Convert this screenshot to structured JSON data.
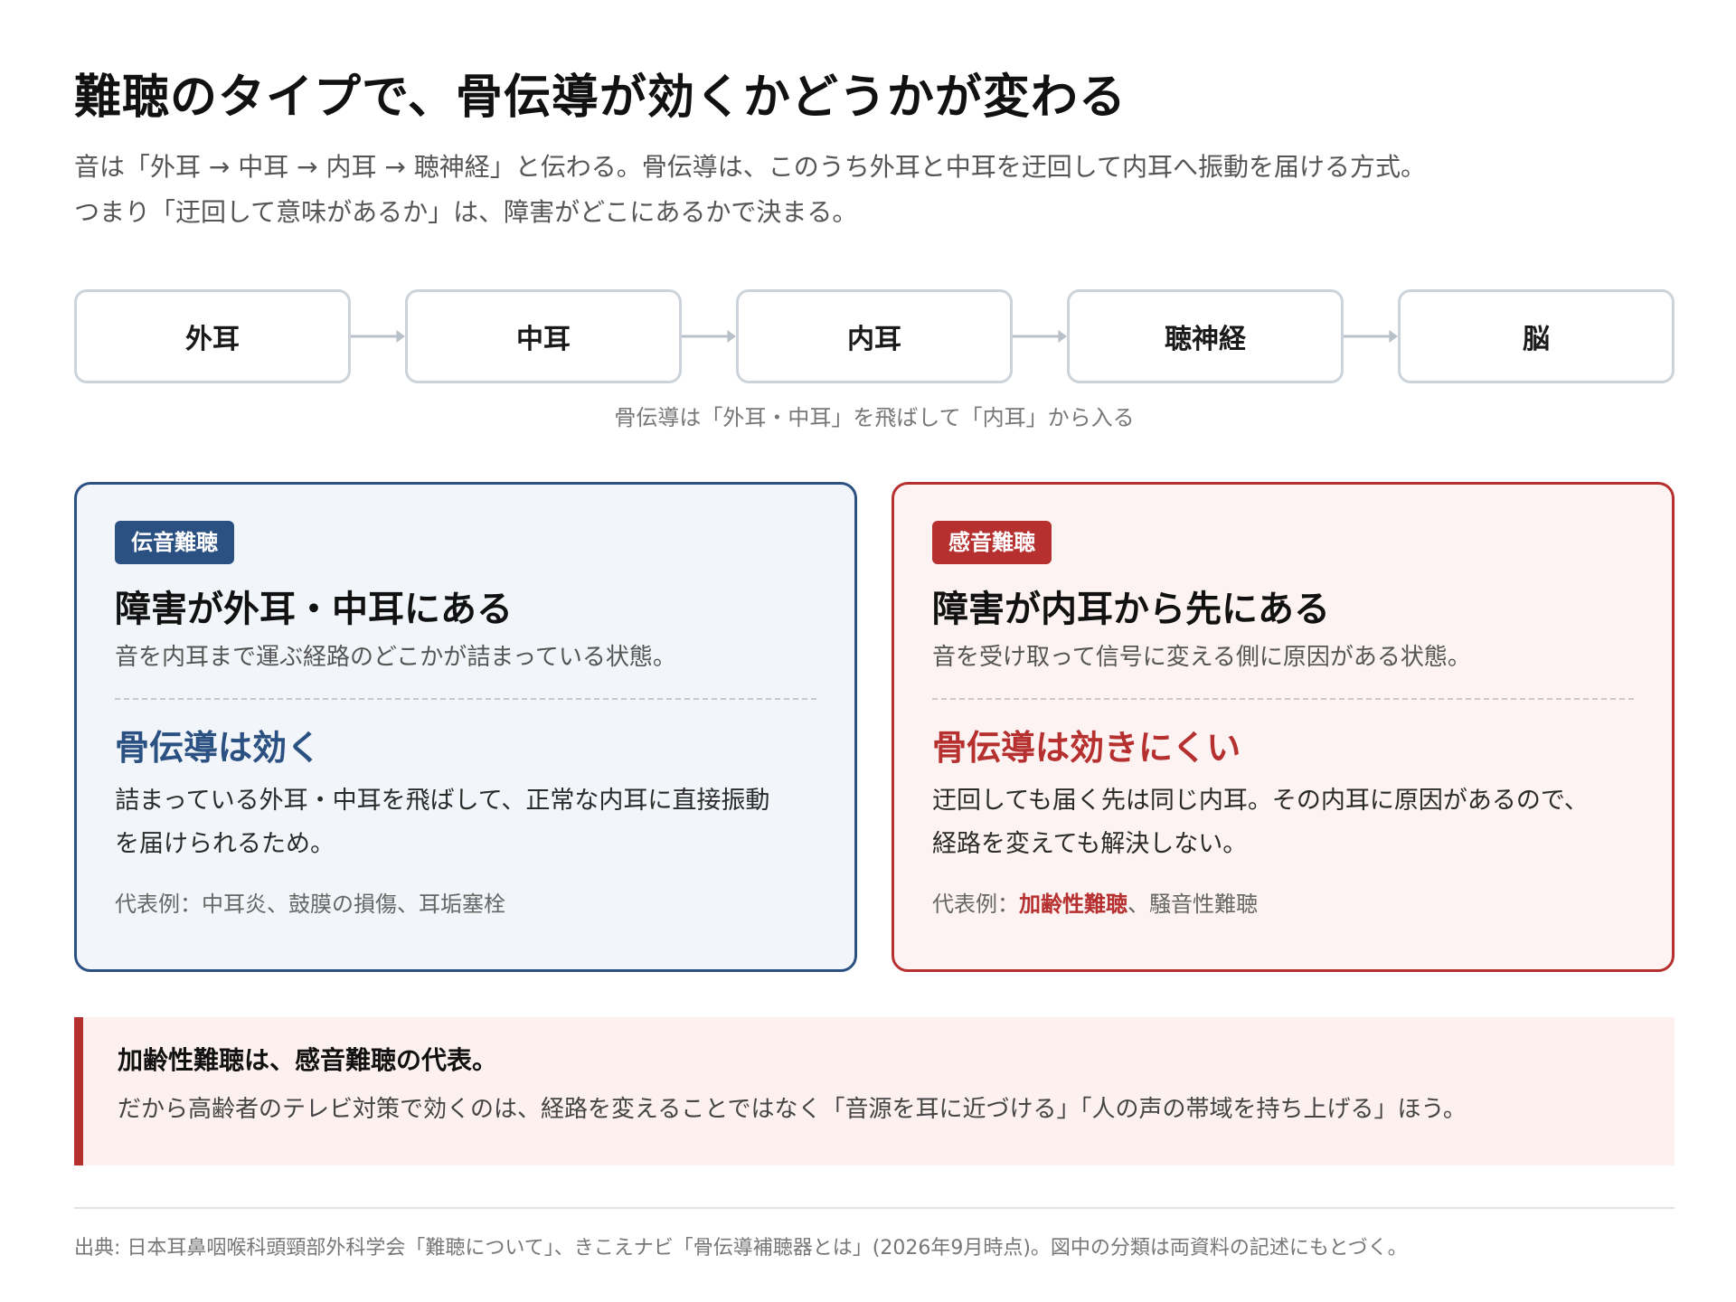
{
  "title": "難聴のタイプで、骨伝導が効くかどうかが変わる",
  "lead": {
    "line1": "音は「外耳 → 中耳 → 内耳 → 聴神経」と伝わる。骨伝導は、このうち外耳と中耳を迂回して内耳へ振動を届ける方式。",
    "line2": "つまり「迂回して意味があるか」は、障害がどこにあるかで決まる。"
  },
  "flow": {
    "steps": [
      "外耳",
      "中耳",
      "内耳",
      "聴神経",
      "脳"
    ],
    "caption": "骨伝導は「外耳・中耳」を飛ばして「内耳」から入る"
  },
  "cards": {
    "conductive": {
      "badge": "伝音難聴",
      "heading": "障害が外耳・中耳にある",
      "subtext": "音を内耳まで運ぶ経路のどこかが詰まっている状態。",
      "verdict": "骨伝導は効く",
      "body_line1": "詰まっている外耳・中耳を飛ばして、正常な内耳に直接振動",
      "body_line2": "を届けられるため。",
      "example": "代表例：中耳炎、鼓膜の損傷、耳垢塞栓"
    },
    "sensorineural": {
      "badge": "感音難聴",
      "heading": "障害が内耳から先にある",
      "subtext": "音を受け取って信号に変える側に原因がある状態。",
      "verdict": "骨伝導は効きにくい",
      "body_line1": "迂回しても届く先は同じ内耳。その内耳に原因があるので、",
      "body_line2": "経路を変えても解決しない。",
      "example_prefix": "代表例：",
      "example_highlight": "加齢性難聴",
      "example_rest": "、騒音性難聴"
    }
  },
  "note": {
    "title": "加齢性難聴は、感音難聴の代表。",
    "body": "だから高齢者のテレビ対策で効くのは、経路を変えることではなく「音源を耳に近づける」「人の声の帯域を持ち上げる」ほう。"
  },
  "source": "出典: 日本耳鼻咽喉科頭頸部外科学会「難聴について」、きこえナビ「骨伝導補聴器とは」(2026年9月時点)。図中の分類は両資料の記述にもとづく。",
  "colors": {
    "blue": "#2b5082",
    "red": "#b5302f",
    "flow_border": "#cdd3da"
  }
}
